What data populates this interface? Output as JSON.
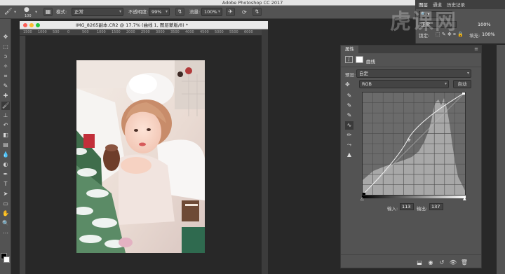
{
  "app": {
    "title": "Adobe Photoshop CC 2017"
  },
  "options_bar": {
    "brush_size": "100",
    "mode_label": "模式:",
    "mode_value": "正常",
    "opacity_label": "不透明度:",
    "opacity_value": "99%",
    "flow_label": "流量:",
    "flow_value": "100%"
  },
  "document": {
    "tab_title": "IMG_8265副本.CR2 @ 17.7% (曲线 1, 图层蒙版/8) *"
  },
  "ruler": {
    "ticks": [
      "1500",
      "1000",
      "500",
      "0",
      "500",
      "1000",
      "1500",
      "2000",
      "2500",
      "3000",
      "3500",
      "4000",
      "4500",
      "5000",
      "5500",
      "6000"
    ]
  },
  "layers_panel": {
    "tabs": [
      "图层",
      "通道",
      "历史记录"
    ],
    "blend_mode": "正常",
    "lock_label": "锁定:",
    "fill_label": "填充:",
    "opacity_value": "100%",
    "fill_value": "100%"
  },
  "properties_panel": {
    "tab": "属性",
    "adjustment_title": "曲线",
    "preset_label": "预设:",
    "preset_value": "自定",
    "channel_value": "RGB",
    "auto_button": "自动",
    "input_label": "输入:",
    "input_value": "113",
    "output_label": "输出:",
    "output_value": "137"
  },
  "watermark": {
    "text": "虎课网"
  },
  "colors": {
    "panel": "#535353",
    "canvas": "#282828",
    "curve": "#e8e8e8"
  }
}
